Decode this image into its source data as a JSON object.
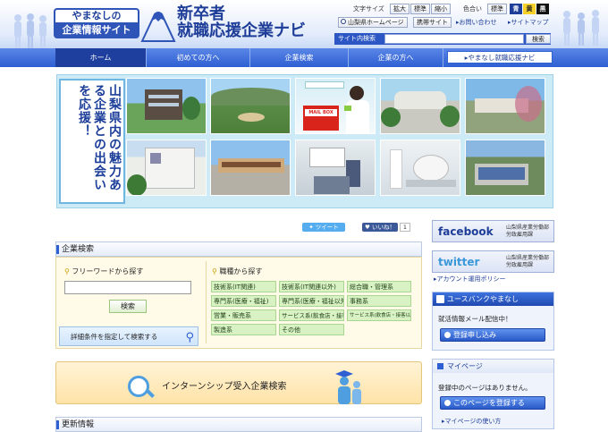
{
  "header": {
    "logo_line1": "やまなしの",
    "logo_line2": "企業情報サイト",
    "title_line1": "新卒者",
    "title_line2": "就職応援企業ナビ",
    "font_size_label": "文字サイズ",
    "font_size_buttons": [
      "拡大",
      "標準",
      "縮小"
    ],
    "color_label": "色合い",
    "color_standard": "標準",
    "color_options": [
      {
        "label": "青",
        "bg": "#1e3d98",
        "fg": "#ffffff"
      },
      {
        "label": "黄",
        "bg": "#f7d12a",
        "fg": "#222222"
      },
      {
        "label": "黒",
        "bg": "#111111",
        "fg": "#ffffff"
      }
    ],
    "links": [
      "山梨県ホームページ",
      "携帯サイト",
      "お問い合わせ",
      "サイトマップ"
    ],
    "search_label": "サイト内検索",
    "search_value": "",
    "search_button": "検索"
  },
  "nav": {
    "items": [
      "ホーム",
      "初めての方へ",
      "企業検索",
      "企業の方へ"
    ],
    "special": "やまなし就職応援ナビ"
  },
  "banner": {
    "text": "山梨県内の魅力ある企業との出会いを応援！",
    "sign": "MAIL BOX"
  },
  "social": {
    "tweet": "ツイート",
    "like": "いいね！",
    "like_count": "1"
  },
  "company_search": {
    "title": "企業検索",
    "freeword_label": "フリーワードから探す",
    "freeword_value": "",
    "search_button": "検索",
    "detail_button": "詳細条件を指定して検索する",
    "job_label": "職種から探す",
    "jobs": [
      "技術系(IT関連)",
      "技術系(IT関連以外)",
      "総合職・管理系",
      "専門系(医療・福祉)",
      "専門系(医療・福祉以外)",
      "事務系",
      "営業・販売系",
      "サービス系(飲食店・接客)",
      "サービス系(飲食店・接客以外)",
      "製造系",
      "その他"
    ]
  },
  "internship": {
    "label": "インターンシップ受入企業検索"
  },
  "updates": {
    "title": "更新情報"
  },
  "right": {
    "facebook": "facebook",
    "facebook_org": [
      "山梨県産業労働部",
      "労政雇用課"
    ],
    "twitter": "twitter",
    "twitter_org": [
      "山梨県産業労働部",
      "労政雇用課"
    ],
    "account_policy": "アカウント運用ポリシー",
    "youth_bank": "ユースバンクやまなし",
    "mail_text": "就活情報メール配信中！",
    "signup": "登録申し込み",
    "mypage": "マイページ",
    "mypage_empty": "登録中のページはありません。",
    "register_page": "このページを登録する",
    "mypage_usage": "マイページの使い方"
  },
  "colors": {
    "brand": "#1e3d98",
    "nav": "#2e5fd3"
  }
}
